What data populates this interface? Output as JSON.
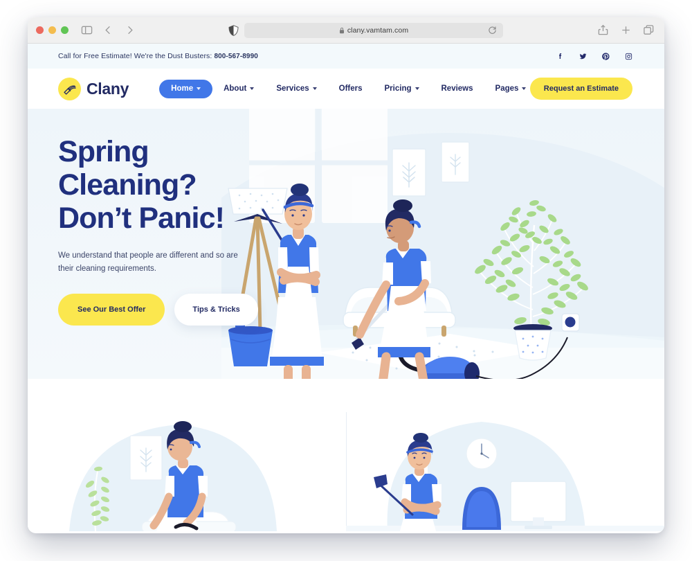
{
  "browser": {
    "url": "clany.vamtam.com",
    "icons": {
      "sidebar": "sidebar-toggle-icon",
      "back": "back-arrow-icon",
      "forward": "forward-arrow-icon",
      "shield": "privacy-shield-icon",
      "lock": "lock-icon",
      "reload": "reload-icon",
      "share": "share-icon",
      "new_tab": "plus-icon",
      "tabs": "tab-overview-icon"
    }
  },
  "topbar": {
    "message": "Call for Free Estimate! We're the Dust Busters: ",
    "phone": "800-567-8990",
    "socials": [
      {
        "name": "facebook-icon",
        "label": "Facebook"
      },
      {
        "name": "twitter-icon",
        "label": "Twitter"
      },
      {
        "name": "pinterest-icon",
        "label": "Pinterest"
      },
      {
        "name": "instagram-icon",
        "label": "Instagram"
      }
    ]
  },
  "nav": {
    "brand": "Clany",
    "logo_icon": "broom-icon",
    "items": [
      {
        "label": "Home",
        "has_dropdown": true,
        "active": true
      },
      {
        "label": "About",
        "has_dropdown": true,
        "active": false
      },
      {
        "label": "Services",
        "has_dropdown": true,
        "active": false
      },
      {
        "label": "Offers",
        "has_dropdown": false,
        "active": false
      },
      {
        "label": "Pricing",
        "has_dropdown": true,
        "active": false
      },
      {
        "label": "Reviews",
        "has_dropdown": false,
        "active": false
      },
      {
        "label": "Pages",
        "has_dropdown": true,
        "active": false
      }
    ],
    "cta_label": "Request an Estimate"
  },
  "hero": {
    "title_line1": "Spring",
    "title_line2": "Cleaning?",
    "title_line3": "Don’t Panic!",
    "subtitle": "We understand that people are different and so are their cleaning requirements.",
    "primary_button": "See Our Best Offer",
    "secondary_button": "Tips & Tricks",
    "illustration": "maid-with-duster-and-maid-vacuuming-living-room"
  },
  "features": {
    "left_illustration": "maid-vacuuming-beside-plant-and-framed-art",
    "right_illustration": "maid-with-squeegee-in-office-with-clock-and-monitor"
  },
  "colors": {
    "accent_blue": "#4177e8",
    "accent_yellow": "#fbe74e",
    "navy": "#222a63",
    "hero_background": "#f2f7fb",
    "plant_green": "#a8d98a"
  }
}
